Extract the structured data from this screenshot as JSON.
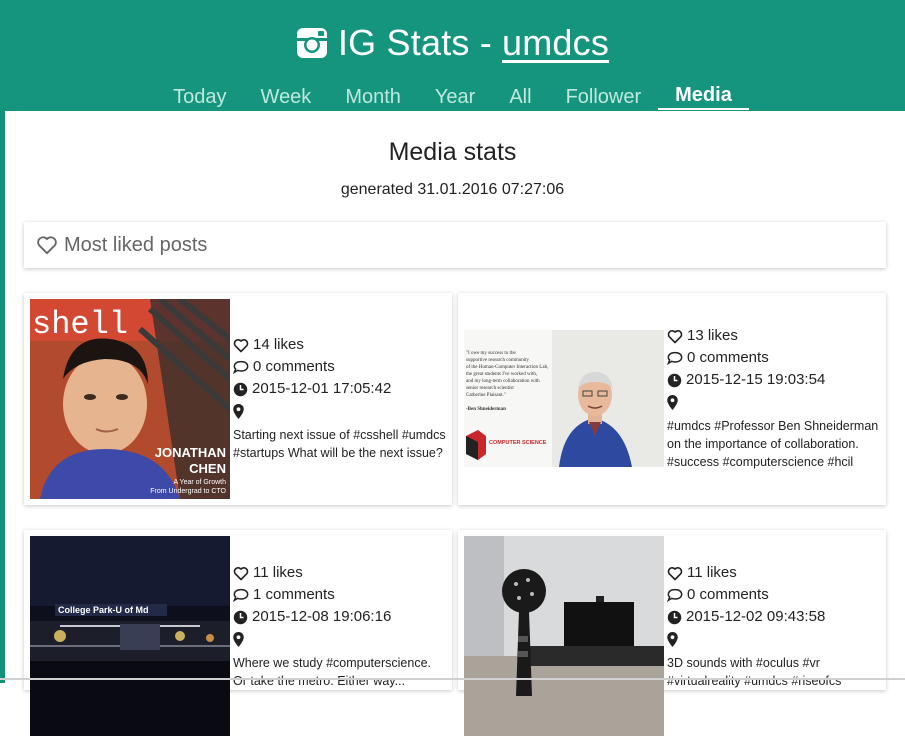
{
  "header": {
    "app_title": "IG Stats - ",
    "username": "umdcs",
    "tabs": [
      {
        "label": "Today",
        "active": false
      },
      {
        "label": "Week",
        "active": false
      },
      {
        "label": "Month",
        "active": false
      },
      {
        "label": "Year",
        "active": false
      },
      {
        "label": "All",
        "active": false
      },
      {
        "label": "Follower",
        "active": false
      },
      {
        "label": "Media",
        "active": true
      }
    ]
  },
  "page": {
    "title": "Media stats",
    "generated": "generated 31.01.2016 07:27:06"
  },
  "section": {
    "title": "Most liked posts",
    "icon": "heart-outline-icon"
  },
  "posts": [
    {
      "likes": "14 likes",
      "comments": "0 comments",
      "date": "2015-12-01 17:05:42",
      "caption": "Starting next issue of #csshell #umdcs #startups What will be the next issue?",
      "image_text": {
        "banner": "shell",
        "name_1": "JONATHAN",
        "name_2": "CHEN",
        "sub_1": "A Year of Growth",
        "sub_2": "From Undergrad to CTO"
      }
    },
    {
      "likes": "13 likes",
      "comments": "0 comments",
      "date": "2015-12-15 19:03:54",
      "caption": "#umdcs #Professor Ben Shneiderman on the importance of collaboration. #success #computerscience #hcil",
      "image_text": {
        "quote": "\"I owe my success to the supportive research community of the Human-Computer Interaction Lab, the great students I've worked with, and my long-term collaboration with senior research scientist Catherine Plaisant.\"",
        "author": "-Ben Shneiderman",
        "badge": "COMPUTER SCIENCE"
      }
    },
    {
      "likes": "11 likes",
      "comments": "1 comments",
      "date": "2015-12-08 19:06:16",
      "caption": "Where we study #computerscience. Or take the metro. Either way...",
      "image_text": {
        "sign": "College Park-U of Md"
      }
    },
    {
      "likes": "11 likes",
      "comments": "0 comments",
      "date": "2015-12-02 09:43:58",
      "caption": "3D sounds with #oculus #vr #virtualreality #umdcs #riseofcs"
    }
  ],
  "colors": {
    "header_bg": "#15957e",
    "tab_inactive": "#bfe8de",
    "tab_active": "#ffffff"
  }
}
